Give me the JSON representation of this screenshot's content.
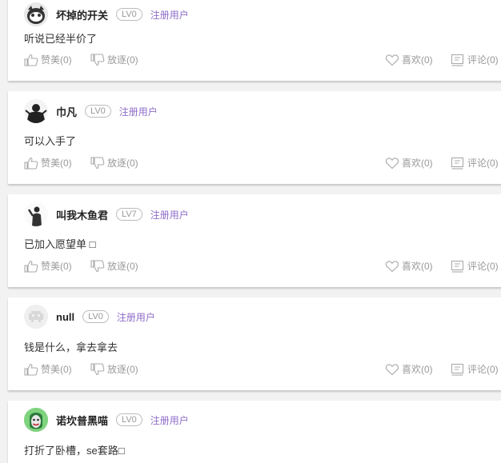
{
  "comments": [
    {
      "username": "坏掉的开关",
      "level": "LV0",
      "role": "注册用户",
      "text": "听说已经半价了",
      "like": "赞美(0)",
      "dislike": "放逐(0)",
      "fav": "喜欢(0)",
      "comment": "评论(0)",
      "avatar": "cat-mask-avatar"
    },
    {
      "username": "巾凡",
      "level": "LV0",
      "role": "注册用户",
      "text": "可以入手了",
      "like": "赞美(0)",
      "dislike": "放逐(0)",
      "fav": "喜欢(0)",
      "comment": "评论(0)",
      "avatar": "dark-silhouette-avatar"
    },
    {
      "username": "叫我木鱼君",
      "level": "LV7",
      "role": "注册用户",
      "text": "已加入愿望单 □",
      "like": "赞美(0)",
      "dislike": "放逐(0)",
      "fav": "喜欢(0)",
      "comment": "评论(0)",
      "avatar": "figure-avatar"
    },
    {
      "username": "null",
      "level": "LV0",
      "role": "注册用户",
      "text": "钱是什么，拿去拿去",
      "like": "赞美(0)",
      "dislike": "放逐(0)",
      "fav": "喜欢(0)",
      "comment": "评论(0)",
      "avatar": "pixel-invader-avatar"
    },
    {
      "username": "诺坎普黑喵",
      "level": "LV0",
      "role": "注册用户",
      "text": "打折了卧槽，se套路□",
      "avatar": "joker-avatar"
    }
  ],
  "colors": {
    "role": "#8e6cc8",
    "muted": "#999999",
    "background": "#f2f2f2"
  }
}
